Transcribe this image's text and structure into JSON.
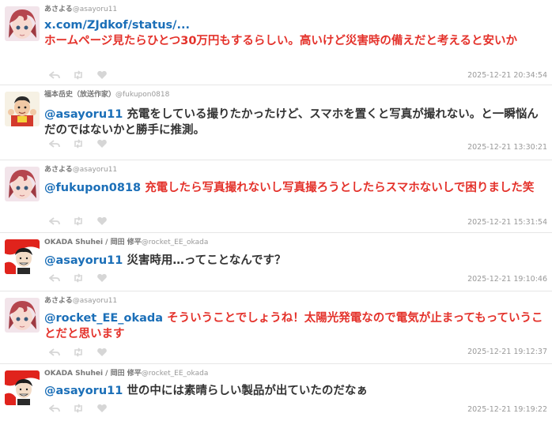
{
  "tweets": [
    {
      "name": "あさよる",
      "handle": "@asayoru11",
      "link": "x.com/ZJdkof/status/...",
      "text": "ホームページ見たらひとつ30万円もするらしい。高いけど災害時の備えだと考えると安いか",
      "timestamp": "2025-12-21 20:34:54"
    },
    {
      "name": "福本岳史（放送作家）",
      "handle": "@fukupon0818",
      "mention": "@asayoru11",
      "text": "充電をしている撮りたかったけど、スマホを置くと写真が撮れない。と一瞬悩んだのではないかと勝手に推測。",
      "timestamp": "2025-12-21 13:30:21"
    },
    {
      "name": "あさよる",
      "handle": "@asayoru11",
      "mention": "@fukupon0818",
      "text": "充電したら写真撮れないし写真撮ろうとしたらスマホないしで困りました笑",
      "timestamp": "2025-12-21 15:31:54"
    },
    {
      "name": "OKADA Shuhei / 岡田 修平",
      "handle": "@rocket_EE_okada",
      "mention": "@asayoru11",
      "text": "災害時用…ってことなんです？",
      "timestamp": "2025-12-21 19:10:46"
    },
    {
      "name": "あさよる",
      "handle": "@asayoru11",
      "mention": "@rocket_EE_okada",
      "text": "そういうことでしょうね！太陽光発電なので電気が止まってもっていうことだと思います",
      "timestamp": "2025-12-21 19:12:37"
    },
    {
      "name": "OKADA Shuhei / 岡田 修平",
      "handle": "@rocket_EE_okada",
      "mention": "@asayoru11",
      "text": "世の中には素晴らしい製品が出ていたのだなぁ",
      "timestamp": "2025-12-21 19:19:22"
    }
  ],
  "icons": {
    "reply": "reply-icon",
    "retweet": "retweet-icon",
    "like": "heart-icon"
  },
  "colors": {
    "mention": "#1b6fb8",
    "highlight_text": "#e4322b",
    "normal_text": "#333333",
    "meta": "#999999"
  }
}
